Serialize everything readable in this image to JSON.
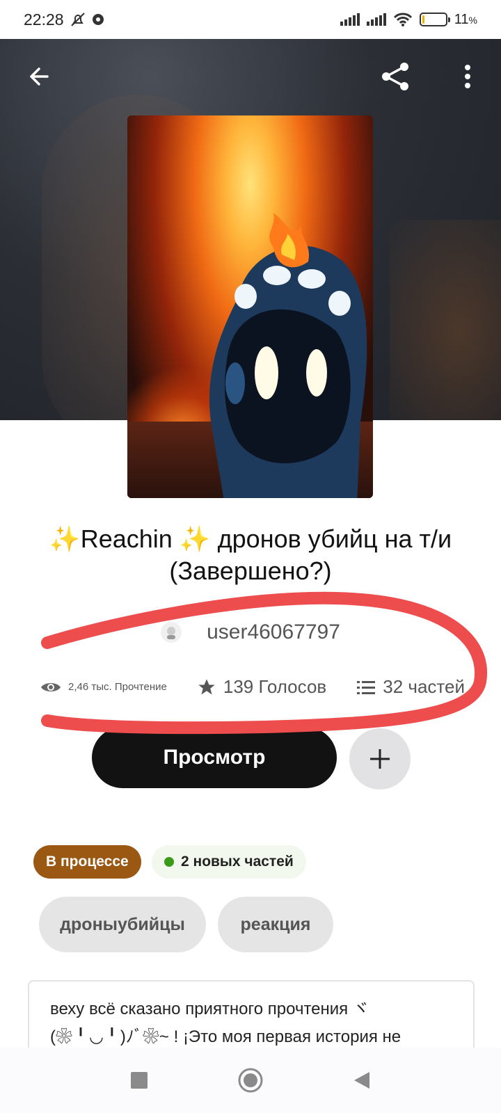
{
  "status_bar": {
    "time": "22:28",
    "battery_percent": "11",
    "battery_suffix": "%",
    "battery_level": 0.11
  },
  "header": {
    "back_icon": "arrow-left-icon",
    "share_icon": "share-icon",
    "more_icon": "more-vertical-icon"
  },
  "story": {
    "title_line1": "✨Reachin ✨ дронов убийц на т/и",
    "title_line2": "(Завершено?)",
    "author": "user46067797",
    "reads": "2,46 тыс. Прочтение",
    "votes": "139 Голосов",
    "parts": "32 частей"
  },
  "actions": {
    "view_label": "Просмотр",
    "add_label": "+"
  },
  "badges": {
    "status": "В процессе",
    "new_parts": "2 новых частей"
  },
  "tags": [
    "дроныубийцы",
    "реакция"
  ],
  "description": {
    "line1": "веху всё сказано приятного прочтения ヾ",
    "line2": "(❀╹◡╹)ﾉﾞ❀~ ! ¡Это моя первая история не"
  },
  "colors": {
    "status_badge": "#9a5812",
    "new_dot": "#3a9a1a",
    "primary_button": "#121212",
    "annotation": "#ee4d4d"
  }
}
